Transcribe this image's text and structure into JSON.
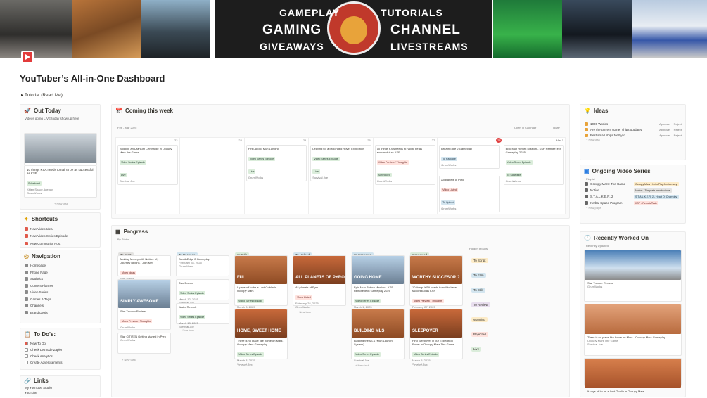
{
  "banner": {
    "gameplay": "GAMEPLAY",
    "tutorials": "TUTORIALS",
    "gaming": "GAMING",
    "channel": "CHANNEL",
    "giveaways": "GIVEAWAYS",
    "livestreams": "LIVESTREAMS"
  },
  "page": {
    "title": "YouTuber’s All-in-One Dashboard",
    "tutorial": "Tutorial (Read Me)"
  },
  "out_today": {
    "title": "Out Today",
    "subtitle": "Videos going LIVE today show up here",
    "thumb_text": "WORTHY SUCCESSOR?",
    "item": "10 things KSA needs to nail to be as successful as KSP",
    "tag": "Scheduled",
    "sub": "Kitten Space Agency",
    "owner": "GrumWorks",
    "new": "+ New task"
  },
  "shortcuts": {
    "title": "Shortcuts",
    "items": [
      "New Video Idea",
      "New Video Series Episode",
      "New Community Post"
    ]
  },
  "navigation": {
    "title": "Navigation",
    "items": [
      "Homepage",
      "Phone Page",
      "Statistics",
      "Content Planner",
      "Video Series",
      "Games & Tags",
      "Channels",
      "Brand Deals"
    ]
  },
  "todos": {
    "title": "To Do's:",
    "items": [
      "New To Do",
      "Check Letmode Zapier",
      "Check Analytics",
      "Create Advertisements"
    ]
  },
  "links": {
    "title": "Links",
    "items": [
      "My YouTube Studio",
      "YouTube"
    ]
  },
  "calendar": {
    "title": "Coming this week",
    "range": "Feb - Mar 2025",
    "open": "Open in Calendar",
    "today": "Today",
    "days": [
      "Sun",
      "Mon",
      "Tue",
      "Wed",
      "Thu",
      "Fri",
      "Sat"
    ],
    "dates": [
      "23",
      "24",
      "25",
      "26",
      "27",
      "28",
      "Mar 1"
    ],
    "events": [
      {
        "title": "Building an Uranium Centrifuge in Occupy Mars the Game",
        "tag": "Video Series Episode",
        "tc": "g",
        "status": "Live",
        "owner": "Survival Joe"
      },
      null,
      {
        "title": "First Apollo Mun Landing",
        "tag": "Video Series Episode",
        "tc": "g",
        "status": "Live",
        "owner": "GrumWorks"
      },
      {
        "title": "Leaving for a prolonged Rover Expedition",
        "tag": "Video Series Episode",
        "tc": "g",
        "status": "Live",
        "owner": "Survival Joe"
      },
      {
        "title": "10 things KSA needs to nail to be as successful as KSP",
        "tag": "Video Preview / Thoughts",
        "tc": "r",
        "status": "Scheduled",
        "owner": "GrumWorks"
      },
      {
        "title": "BreathEdge 2 Gameplay",
        "tag": "To Package",
        "tc": "b",
        "status": "",
        "owner": "GrumWorks",
        "title2": "All planets of Pyro",
        "tag2": "Video Listed",
        "status2": "To Upload",
        "owner2": "GrumWorks"
      },
      {
        "title": "Epic Mun Return Mission - KSP RemoteTech Gameplay 2025",
        "tag": "Video Series Episode",
        "tc": "g",
        "status": "To Schedule",
        "owner": "GrumWorks"
      }
    ]
  },
  "progress": {
    "title": "Progress",
    "view": "By Status",
    "hidden": "Hidden groups",
    "hidden_items": [
      "To Script",
      "To Film",
      "To Edit",
      "To Review",
      "Warning",
      "Rejected",
      "Live"
    ],
    "columns": [
      {
        "name": "To Start",
        "cards": [
          {
            "title": "Making Money with Notion: My Journey Begins - Join Me!",
            "tag": "Video Ideas",
            "owner": "Star Notion"
          },
          {
            "thumb": "SIMPLY AWESOME",
            "title": "Star Trucker Review",
            "tag": "Video Preview / Thoughts",
            "owner": "GrumWorks"
          },
          {
            "title": "Star CITIZEN Getting started in Pyro",
            "owner": "GrumWorks"
          }
        ]
      },
      {
        "name": "To Package",
        "cards": [
          {
            "title": "BreathEdge 2 Gameplay",
            "date": "February 28, 2025",
            "owner": "GrumWorks"
          },
          {
            "title": "Two Dozen",
            "tag": "Video Series Episode",
            "date": "March 12, 2025",
            "owner": "Survival Joe"
          },
          {
            "title": "Water Rework",
            "tag": "Video Series Episode",
            "date": "March 13, 2025",
            "owner": "Survival Joe"
          }
        ]
      },
      {
        "name": "To Edit",
        "cards": [
          {
            "thumb": "FULL",
            "title": "It pays off to be a Lost Goblin in Occupy Mars",
            "tag": "Video Series Episode",
            "date": "March 8, 2025",
            "owner": "Survival Joe"
          },
          {
            "thumb": "HOME, SWEET HOME",
            "title": "There is no place like home on Mars - Occupy Mars Gameplay",
            "tag": "Video Series Episode",
            "date": "March 8, 2025",
            "owner": "Survival Joe"
          }
        ]
      },
      {
        "name": "To Upload",
        "cards": [
          {
            "thumb": "ALL PLANETS OF PYRO",
            "title": "All planets of Pyro",
            "tag": "Video Listed",
            "date": "February 28, 2025",
            "owner": "GrumWorks"
          }
        ]
      },
      {
        "name": "To Schedule",
        "cards": [
          {
            "thumb": "GOING HOME",
            "title": "Epic Mun Return Mission - KSP RemoteTech Gameplay 2025",
            "tag": "Video Series Episode",
            "date": "March 1, 2025",
            "owner": "GrumWorks"
          },
          {
            "thumb": "BUILDING MLS",
            "title": "Building the MLS (Mun Launch System)",
            "tag": "Video Series Episode",
            "date": "",
            "owner": "Survival Joe"
          }
        ]
      },
      {
        "name": "Scheduled",
        "cards": [
          {
            "thumb": "WORTHY SUCCESOR ?",
            "title": "10 things KSA needs to nail to be as successful as KSP",
            "tag": "Video Preview / Thoughts",
            "date": "February 27, 2025",
            "owner": "GrumWorks"
          },
          {
            "thumb": "SLEEPOVER",
            "title": "First Sleepover in our Expedition Rover in Occupy Mars The Game",
            "tag": "Video Series Episode",
            "date": "March 5, 2025",
            "owner": "Survival Joe"
          }
        ]
      }
    ]
  },
  "ideas": {
    "title": "Ideas",
    "items": [
      {
        "title": "1000 Worlds"
      },
      {
        "title": "Are the current starter ships outdated"
      },
      {
        "title": "Best small ships for Pyro"
      }
    ],
    "approve": "Approve",
    "reject": "Reject",
    "new": "+ New task"
  },
  "series": {
    "title": "Ongoing Video Series",
    "view": "Playlist",
    "items": [
      {
        "name": "Occupy Mars: The Game",
        "tag": "Occupy Mars - Let's Play Anniversary",
        "tc": "y"
      },
      {
        "name": "Notion",
        "tag": "Notion - Template Introductions",
        "tc": "gr"
      },
      {
        "name": "S.T.A.L.K.E.R. 2",
        "tag": "S.T.A.L.K.E.R. 2 - Heart Of Chornobyl",
        "tc": "b"
      },
      {
        "name": "Kerbal Space Program",
        "tag": "KSP - RemoteTech",
        "tc": "r"
      }
    ],
    "new": "+ New page"
  },
  "recent": {
    "title": "Recently Worked On",
    "view": "Recently Updated",
    "items": [
      {
        "title": "Star Trucker Review",
        "owner": "GrumWorks"
      },
      {
        "title": "There is no place like home on Mars - Occupy Mars Gameplay",
        "sub": "Occupy Mars The Game",
        "owner": "Survival Joe"
      },
      {
        "title": "It pays off to be a Lost Goblin in Occupy Mars"
      }
    ]
  }
}
